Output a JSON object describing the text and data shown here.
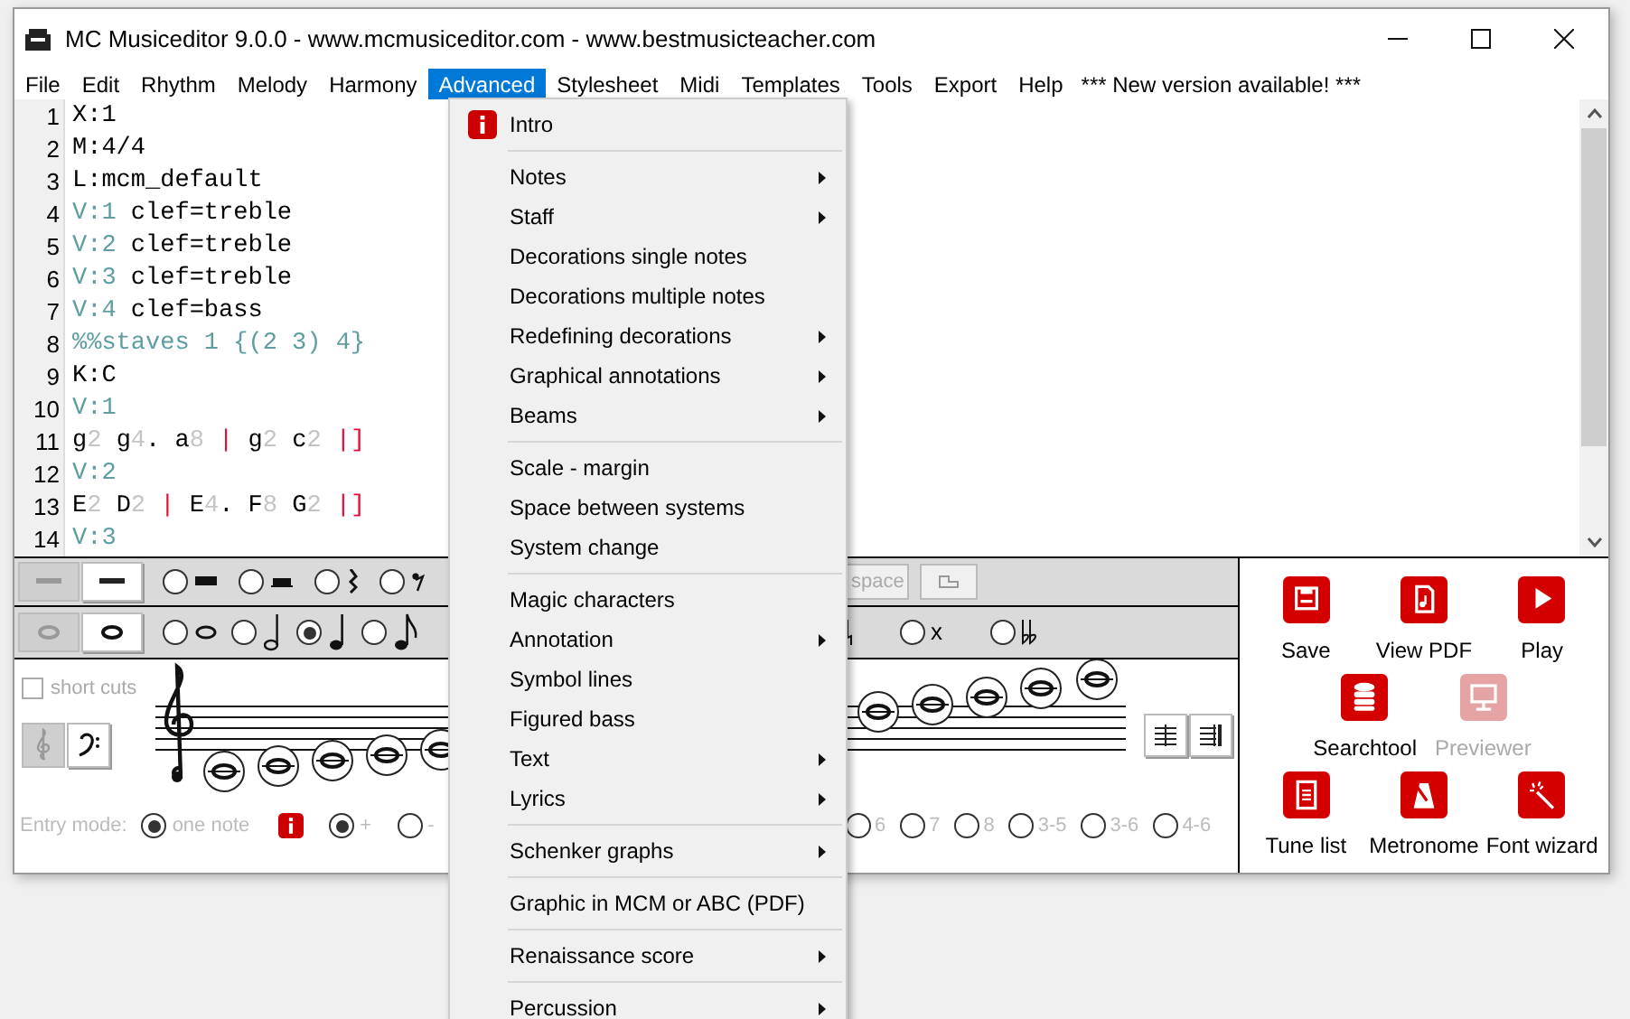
{
  "window": {
    "title": "MC Musiceditor 9.0.0 - www.mcmusiceditor.com - www.bestmusicteacher.com"
  },
  "menubar": {
    "items": [
      {
        "label": "File",
        "selected": false
      },
      {
        "label": "Edit",
        "selected": false
      },
      {
        "label": "Rhythm",
        "selected": false
      },
      {
        "label": "Melody",
        "selected": false
      },
      {
        "label": "Harmony",
        "selected": false
      },
      {
        "label": "Advanced",
        "selected": true
      },
      {
        "label": "Stylesheet",
        "selected": false
      },
      {
        "label": "Midi",
        "selected": false
      },
      {
        "label": "Templates",
        "selected": false
      },
      {
        "label": "Tools",
        "selected": false
      },
      {
        "label": "Export",
        "selected": false
      },
      {
        "label": "Help",
        "selected": false
      }
    ],
    "notice": "*** New version available! ***"
  },
  "editor": {
    "lines": [
      {
        "number": "1",
        "segments": [
          {
            "text": "X:1",
            "kind": "plain"
          }
        ]
      },
      {
        "number": "2",
        "segments": [
          {
            "text": "M:4/4",
            "kind": "plain"
          }
        ]
      },
      {
        "number": "3",
        "segments": [
          {
            "text": "L:mcm_default",
            "kind": "plain"
          }
        ]
      },
      {
        "number": "4",
        "segments": [
          {
            "text": "V:1",
            "kind": "voice"
          },
          {
            "text": " clef=treble",
            "kind": "plain"
          }
        ]
      },
      {
        "number": "5",
        "segments": [
          {
            "text": "V:2",
            "kind": "voice"
          },
          {
            "text": " clef=treble",
            "kind": "plain"
          }
        ]
      },
      {
        "number": "6",
        "segments": [
          {
            "text": "V:3",
            "kind": "voice"
          },
          {
            "text": " clef=treble",
            "kind": "plain"
          }
        ]
      },
      {
        "number": "7",
        "segments": [
          {
            "text": "V:4",
            "kind": "voice"
          },
          {
            "text": " clef=bass",
            "kind": "plain"
          }
        ]
      },
      {
        "number": "8",
        "segments": [
          {
            "text": "%%staves 1 {(2 3) 4}",
            "kind": "voice"
          }
        ]
      },
      {
        "number": "9",
        "segments": [
          {
            "text": "K:C",
            "kind": "plain"
          }
        ]
      },
      {
        "number": "10",
        "segments": [
          {
            "text": "V:1",
            "kind": "voice"
          }
        ]
      },
      {
        "number": "11",
        "segments": [
          {
            "text": "g",
            "kind": "plain"
          },
          {
            "text": "2",
            "kind": "duration"
          },
          {
            "text": " g",
            "kind": "plain"
          },
          {
            "text": "4",
            "kind": "duration"
          },
          {
            "text": ". a",
            "kind": "plain"
          },
          {
            "text": "8",
            "kind": "duration"
          },
          {
            "text": " | ",
            "kind": "bar"
          },
          {
            "text": "g",
            "kind": "plain"
          },
          {
            "text": "2",
            "kind": "duration"
          },
          {
            "text": " c",
            "kind": "plain"
          },
          {
            "text": "2",
            "kind": "duration"
          },
          {
            "text": " |]",
            "kind": "bar"
          }
        ]
      },
      {
        "number": "12",
        "segments": [
          {
            "text": "V:2",
            "kind": "voice"
          }
        ]
      },
      {
        "number": "13",
        "segments": [
          {
            "text": "E",
            "kind": "plain"
          },
          {
            "text": "2",
            "kind": "duration"
          },
          {
            "text": " D",
            "kind": "plain"
          },
          {
            "text": "2",
            "kind": "duration"
          },
          {
            "text": " | ",
            "kind": "bar"
          },
          {
            "text": "E",
            "kind": "plain"
          },
          {
            "text": "4",
            "kind": "duration"
          },
          {
            "text": ". F",
            "kind": "plain"
          },
          {
            "text": "8",
            "kind": "duration"
          },
          {
            "text": " G",
            "kind": "plain"
          },
          {
            "text": "2",
            "kind": "duration"
          },
          {
            "text": " |]",
            "kind": "bar"
          }
        ]
      },
      {
        "number": "14",
        "segments": [
          {
            "text": "V:3",
            "kind": "voice"
          }
        ]
      }
    ]
  },
  "rest_row": {
    "toggles": [
      {
        "selected": true
      },
      {
        "selected": false
      }
    ],
    "options": [
      {
        "selected": false
      },
      {
        "selected": false
      },
      {
        "selected": false
      },
      {
        "selected": false
      }
    ],
    "space_button": "space"
  },
  "note_row": {
    "toggles": [
      {
        "selected": true
      },
      {
        "selected": false
      }
    ],
    "options": [
      {
        "selected": false
      },
      {
        "selected": false
      },
      {
        "selected": true
      },
      {
        "selected": false
      }
    ],
    "accidentals": [
      {
        "kind": "text",
        "label": "x",
        "selected": false
      },
      {
        "kind": "double_flat",
        "selected": false
      }
    ]
  },
  "staff_area": {
    "short_cuts": {
      "label": "short cuts",
      "checked": false
    },
    "clefs": [
      {
        "selected": true
      },
      {
        "selected": false
      }
    ]
  },
  "entry": {
    "label": "Entry mode:",
    "mode": {
      "label": "one note",
      "selected": true
    },
    "signs": [
      {
        "label": "+",
        "selected": true
      },
      {
        "label": "-",
        "selected": false
      }
    ],
    "intervals": [
      {
        "label": "6",
        "selected": false
      },
      {
        "label": "7",
        "selected": false
      },
      {
        "label": "8",
        "selected": false
      },
      {
        "label": "3-5",
        "selected": false
      },
      {
        "label": "3-6",
        "selected": false
      },
      {
        "label": "4-6",
        "selected": false
      }
    ]
  },
  "actions": [
    {
      "label": "Save",
      "disabled": false
    },
    {
      "label": "View PDF",
      "disabled": false
    },
    {
      "label": "Play",
      "disabled": false
    },
    {
      "label": "Searchtool",
      "disabled": false
    },
    {
      "label": "Previewer",
      "disabled": true
    },
    {
      "label": "Tune list",
      "disabled": false
    },
    {
      "label": "Metronome",
      "disabled": false
    },
    {
      "label": "Font wizard",
      "disabled": false
    }
  ],
  "dropdown": {
    "groups": [
      [
        {
          "label": "Intro",
          "kind": "info",
          "submenu": false
        }
      ],
      [
        {
          "label": "Notes",
          "kind": "plain",
          "submenu": true
        },
        {
          "label": "Staff",
          "kind": "plain",
          "submenu": true
        },
        {
          "label": "Decorations single notes",
          "kind": "plain",
          "submenu": false
        },
        {
          "label": "Decorations multiple notes",
          "kind": "plain",
          "submenu": false
        },
        {
          "label": "Redefining decorations",
          "kind": "plain",
          "submenu": true
        },
        {
          "label": "Graphical annotations",
          "kind": "plain",
          "submenu": true
        },
        {
          "label": "Beams",
          "kind": "plain",
          "submenu": true
        }
      ],
      [
        {
          "label": "Scale - margin",
          "kind": "plain",
          "submenu": false
        },
        {
          "label": "Space between systems",
          "kind": "plain",
          "submenu": false
        },
        {
          "label": "System change",
          "kind": "plain",
          "submenu": false
        }
      ],
      [
        {
          "label": "Magic characters",
          "kind": "plain",
          "submenu": false
        },
        {
          "label": "Annotation",
          "kind": "plain",
          "submenu": true
        },
        {
          "label": "Symbol lines",
          "kind": "plain",
          "submenu": false
        },
        {
          "label": "Figured bass",
          "kind": "plain",
          "submenu": false
        },
        {
          "label": "Text",
          "kind": "plain",
          "submenu": true
        },
        {
          "label": "Lyrics",
          "kind": "plain",
          "submenu": true
        }
      ],
      [
        {
          "label": "Schenker graphs",
          "kind": "plain",
          "submenu": true
        }
      ],
      [
        {
          "label": "Graphic in MCM or ABC (PDF)",
          "kind": "plain",
          "submenu": false
        }
      ],
      [
        {
          "label": "Renaissance score",
          "kind": "plain",
          "submenu": true
        }
      ],
      [
        {
          "label": "Percussion",
          "kind": "plain",
          "submenu": true
        }
      ]
    ]
  }
}
